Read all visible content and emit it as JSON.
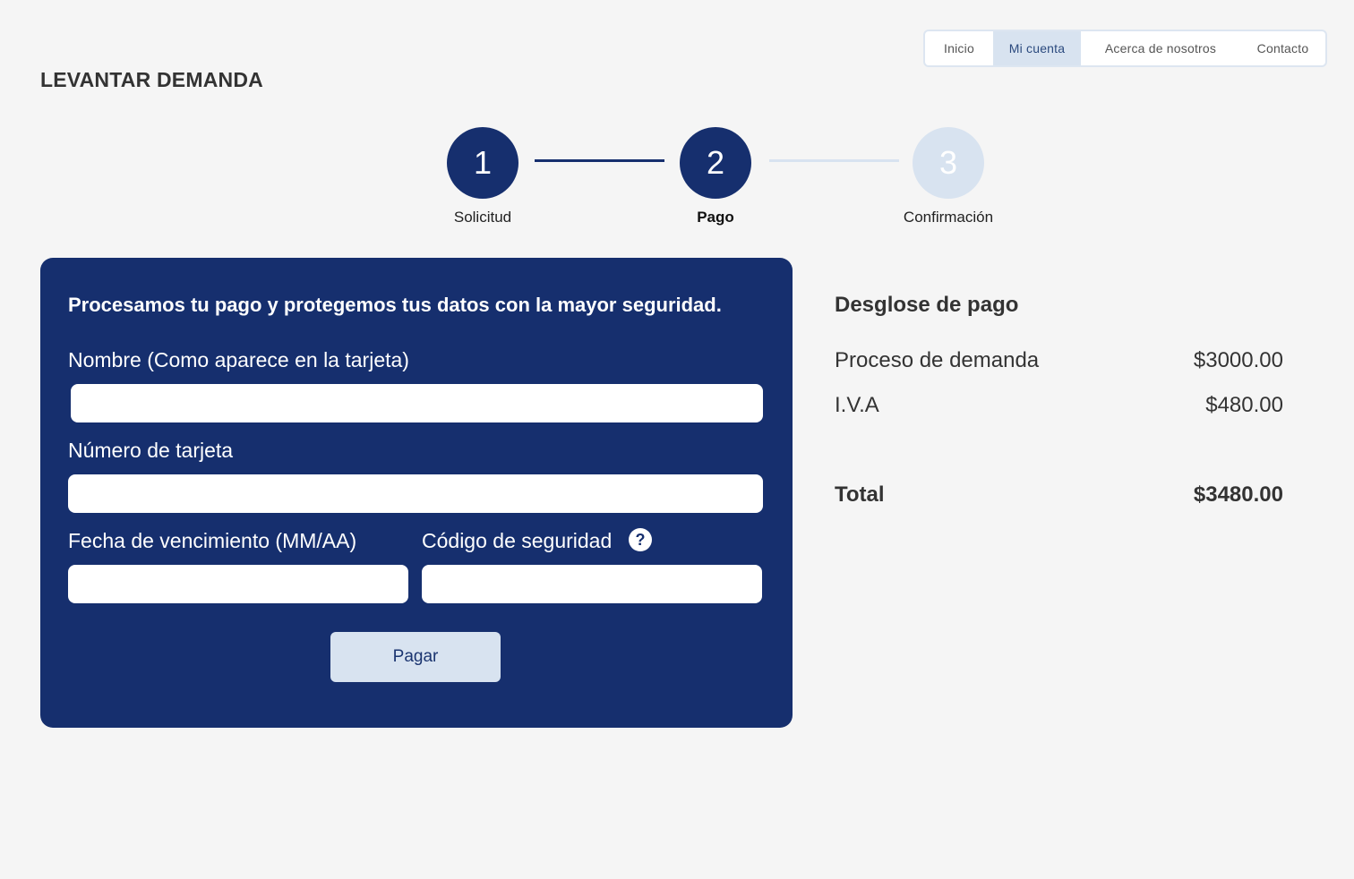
{
  "nav": {
    "items": [
      {
        "label": "Inicio"
      },
      {
        "label": "Mi cuenta"
      },
      {
        "label": "Acerca de nosotros"
      },
      {
        "label": "Contacto"
      }
    ]
  },
  "page_title": "LEVANTAR DEMANDA",
  "stepper": {
    "steps": [
      {
        "number": "1",
        "label": "Solicitud"
      },
      {
        "number": "2",
        "label": "Pago"
      },
      {
        "number": "3",
        "label": "Confirmación"
      }
    ]
  },
  "payment_form": {
    "intro": "Procesamos tu pago y protegemos tus datos con la mayor seguridad.",
    "name_label": "Nombre (Como aparece en la tarjeta)",
    "name_value": "",
    "card_label": "Número de tarjeta",
    "card_value": "",
    "expiry_label": "Fecha de vencimiento (MM/AA)",
    "expiry_value": "",
    "cvv_label": "Código de seguridad",
    "cvv_value": "",
    "help_glyph": "?",
    "submit_label": "Pagar"
  },
  "summary": {
    "title": "Desglose de pago",
    "rows": [
      {
        "label": "Proceso de demanda",
        "amount": "$3000.00"
      },
      {
        "label": "I.V.A",
        "amount": "$480.00"
      }
    ],
    "total_label": "Total",
    "total_amount": "$3480.00"
  },
  "colors": {
    "primary": "#162f6e",
    "accent_light": "#d8e3f0",
    "background": "#f5f5f5"
  }
}
